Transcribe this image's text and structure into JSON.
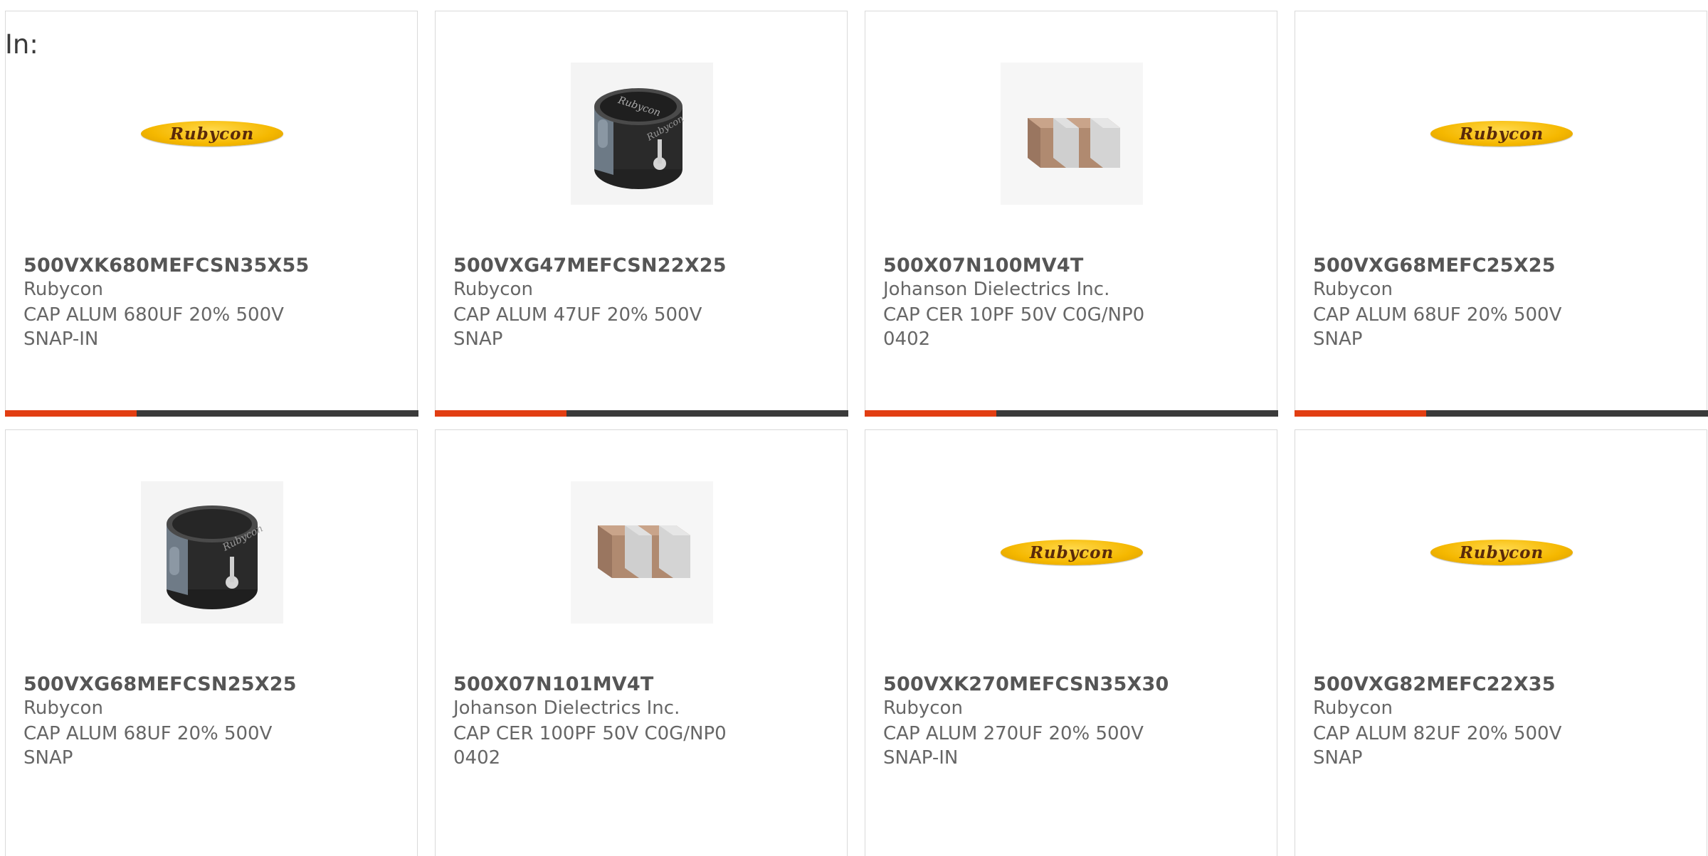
{
  "page": {
    "label": "In:"
  },
  "colors": {
    "accent": "#e23e12",
    "track": "#3a3a3a",
    "logo": "#f5b800"
  },
  "products": [
    {
      "part_number": "500VXK680MEFCSN35X55",
      "manufacturer": "Rubycon",
      "description": "CAP ALUM 680UF 20% 500V SNAP-IN",
      "image": "rubycon-logo",
      "logo_text": "Rubycon",
      "progress": 0.32
    },
    {
      "part_number": "500VXG47MEFCSN22X25",
      "manufacturer": "Rubycon",
      "description": "CAP ALUM 47UF 20% 500V SNAP",
      "image": "electrolytic-capacitor-photo",
      "progress": 0.32
    },
    {
      "part_number": "500X07N100MV4T",
      "manufacturer": "Johanson Dielectrics Inc.",
      "description": "CAP CER 10PF 50V C0G/NP0 0402",
      "image": "chip-capacitor-photo",
      "progress": 0.32
    },
    {
      "part_number": "500VXG68MEFC25X25",
      "manufacturer": "Rubycon",
      "description": "CAP ALUM 68UF 20% 500V SNAP",
      "image": "rubycon-logo",
      "logo_text": "Rubycon",
      "progress": 0.32
    },
    {
      "part_number": "500VXG68MEFCSN25X25",
      "manufacturer": "Rubycon",
      "description": "CAP ALUM 68UF 20% 500V SNAP",
      "image": "electrolytic-capacitor-photo"
    },
    {
      "part_number": "500X07N101MV4T",
      "manufacturer": "Johanson Dielectrics Inc.",
      "description": "CAP CER 100PF 50V C0G/NP0 0402",
      "image": "chip-capacitor-photo"
    },
    {
      "part_number": "500VXK270MEFCSN35X30",
      "manufacturer": "Rubycon",
      "description": "CAP ALUM 270UF 20% 500V SNAP-IN",
      "image": "rubycon-logo",
      "logo_text": "Rubycon"
    },
    {
      "part_number": "500VXG82MEFC22X35",
      "manufacturer": "Rubycon",
      "description": "CAP ALUM 82UF 20% 500V SNAP",
      "image": "rubycon-logo",
      "logo_text": "Rubycon"
    }
  ]
}
